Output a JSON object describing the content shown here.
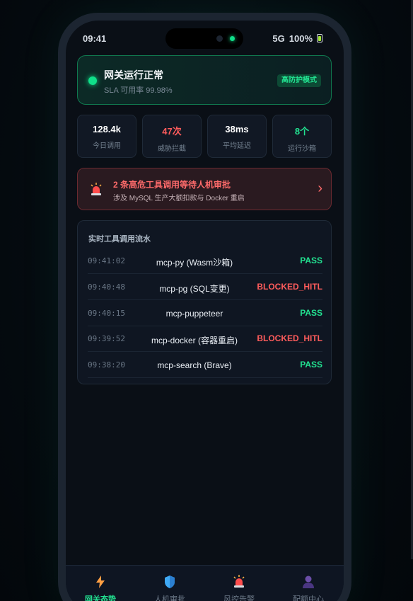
{
  "status_bar": {
    "time": "09:41",
    "network": "5G",
    "battery": "100%"
  },
  "gateway": {
    "title": "网关运行正常",
    "sla": "SLA 可用率 99.98%",
    "mode": "高防护模式",
    "colors": {
      "ok": "#10e08a",
      "danger": "#ff5c5c"
    }
  },
  "metrics": [
    {
      "value": "128.4k",
      "label": "今日调用",
      "color": "#ffffff"
    },
    {
      "value": "47次",
      "label": "威胁拦截",
      "color": "#ff5c5c"
    },
    {
      "value": "38ms",
      "label": "平均延迟",
      "color": "#ffffff"
    },
    {
      "value": "8个",
      "label": "运行沙箱",
      "color": "#22e090"
    }
  ],
  "alert": {
    "icon": "siren-icon",
    "title": "2 条高危工具调用等待人机审批",
    "subtitle": "涉及 MySQL 生产大额扣款与 Docker 重启",
    "chevron": "›"
  },
  "flow": {
    "title": "实时工具调用流水",
    "rows": [
      {
        "time": "09:41:02",
        "name": "mcp-py (Wasm沙箱)",
        "status": "PASS"
      },
      {
        "time": "09:40:48",
        "name": "mcp-pg (SQL变更)",
        "status": "BLOCKED_HITL"
      },
      {
        "time": "09:40:15",
        "name": "mcp-puppeteer",
        "status": "PASS"
      },
      {
        "time": "09:39:52",
        "name": "mcp-docker (容器重启)",
        "status": "BLOCKED_HITL"
      },
      {
        "time": "09:38:20",
        "name": "mcp-search (Brave)",
        "status": "PASS"
      }
    ]
  },
  "tabs": [
    {
      "label": "网关态势",
      "icon": "lightning-icon",
      "active": true
    },
    {
      "label": "人机审批",
      "icon": "shield-icon",
      "active": false
    },
    {
      "label": "风控告警",
      "icon": "siren-icon",
      "active": false
    },
    {
      "label": "配额中心",
      "icon": "user-icon",
      "active": false
    }
  ]
}
